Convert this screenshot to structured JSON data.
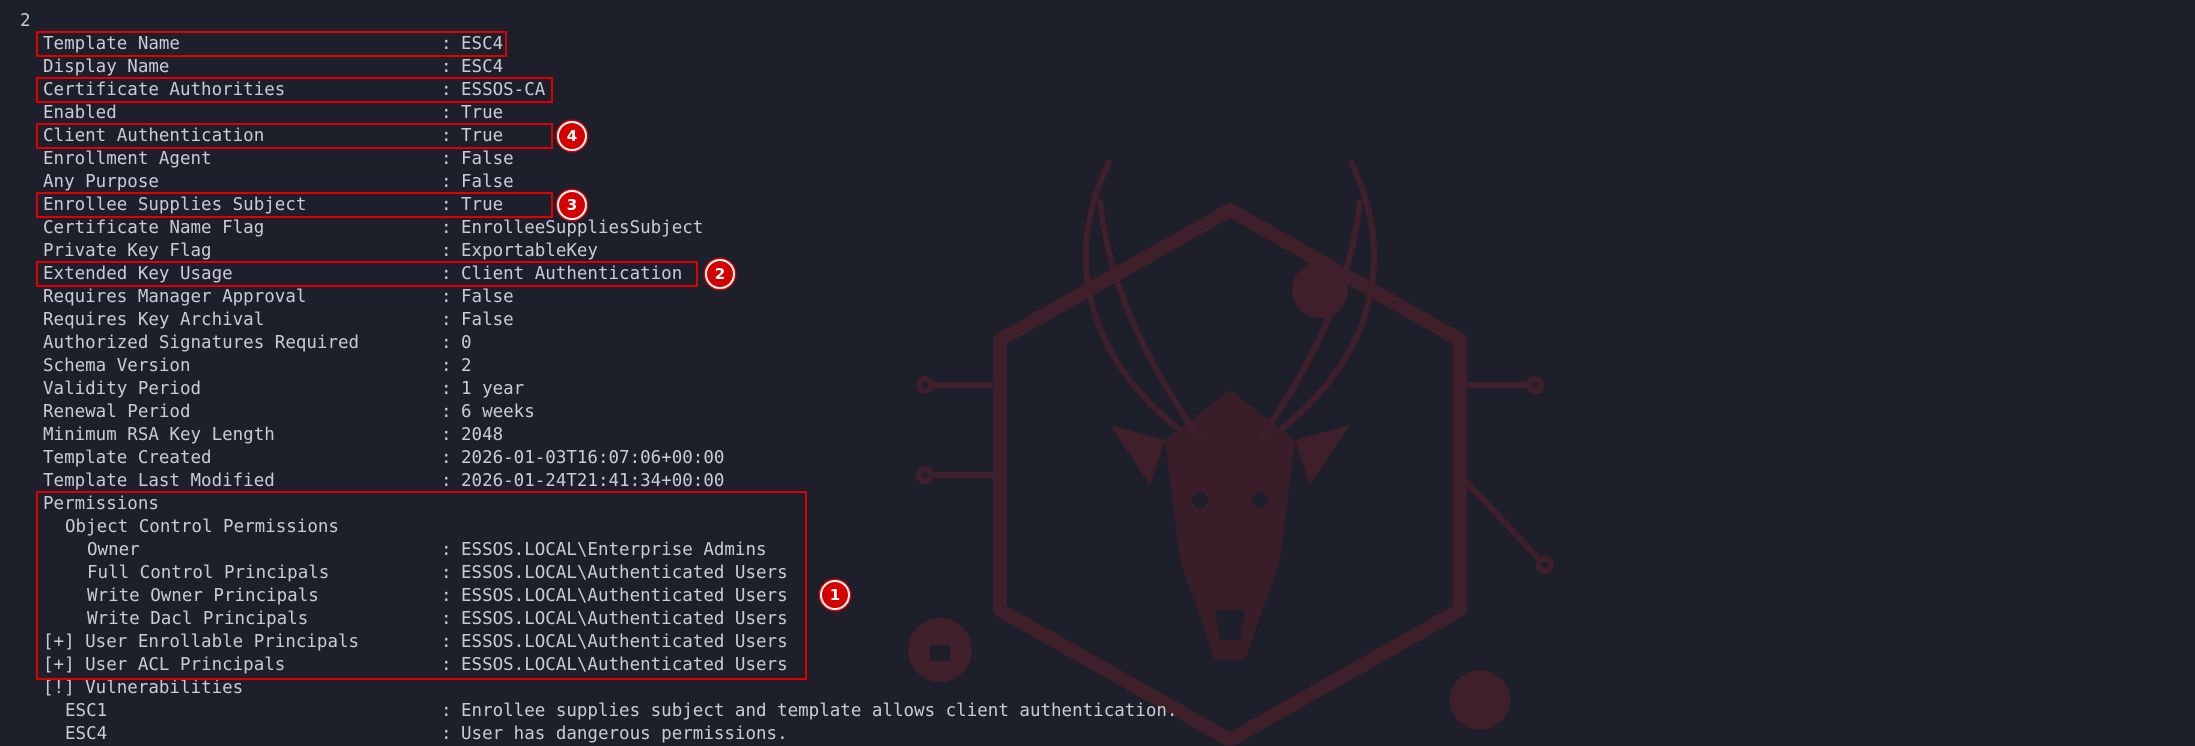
{
  "prompt_number": "2",
  "rows": [
    {
      "key": "Template Name",
      "indent": 0,
      "value": "ESC4"
    },
    {
      "key": "Display Name",
      "indent": 0,
      "value": "ESC4"
    },
    {
      "key": "Certificate Authorities",
      "indent": 0,
      "value": "ESSOS-CA"
    },
    {
      "key": "Enabled",
      "indent": 0,
      "value": "True"
    },
    {
      "key": "Client Authentication",
      "indent": 0,
      "value": "True"
    },
    {
      "key": "Enrollment Agent",
      "indent": 0,
      "value": "False"
    },
    {
      "key": "Any Purpose",
      "indent": 0,
      "value": "False"
    },
    {
      "key": "Enrollee Supplies Subject",
      "indent": 0,
      "value": "True"
    },
    {
      "key": "Certificate Name Flag",
      "indent": 0,
      "value": "EnrolleeSuppliesSubject"
    },
    {
      "key": "Private Key Flag",
      "indent": 0,
      "value": "ExportableKey"
    },
    {
      "key": "Extended Key Usage",
      "indent": 0,
      "value": "Client Authentication"
    },
    {
      "key": "Requires Manager Approval",
      "indent": 0,
      "value": "False"
    },
    {
      "key": "Requires Key Archival",
      "indent": 0,
      "value": "False"
    },
    {
      "key": "Authorized Signatures Required",
      "indent": 0,
      "value": "0"
    },
    {
      "key": "Schema Version",
      "indent": 0,
      "value": "2"
    },
    {
      "key": "Validity Period",
      "indent": 0,
      "value": "1 year"
    },
    {
      "key": "Renewal Period",
      "indent": 0,
      "value": "6 weeks"
    },
    {
      "key": "Minimum RSA Key Length",
      "indent": 0,
      "value": "2048"
    },
    {
      "key": "Template Created",
      "indent": 0,
      "value": "2026-01-03T16:07:06+00:00"
    },
    {
      "key": "Template Last Modified",
      "indent": 0,
      "value": "2026-01-24T21:41:34+00:00"
    },
    {
      "key": "Permissions",
      "indent": 0,
      "value": null
    },
    {
      "key": "Object Control Permissions",
      "indent": 1,
      "value": null
    },
    {
      "key": "Owner",
      "indent": 2,
      "value": "ESSOS.LOCAL\\Enterprise Admins"
    },
    {
      "key": "Full Control Principals",
      "indent": 2,
      "value": "ESSOS.LOCAL\\Authenticated Users"
    },
    {
      "key": "Write Owner Principals",
      "indent": 2,
      "value": "ESSOS.LOCAL\\Authenticated Users"
    },
    {
      "key": "Write Dacl Principals",
      "indent": 2,
      "value": "ESSOS.LOCAL\\Authenticated Users"
    },
    {
      "key": "[+] User Enrollable Principals",
      "indent": 0,
      "value": "ESSOS.LOCAL\\Authenticated Users"
    },
    {
      "key": "[+] User ACL Principals",
      "indent": 0,
      "value": "ESSOS.LOCAL\\Authenticated Users"
    },
    {
      "key": "[!] Vulnerabilities",
      "indent": 0,
      "value": null
    },
    {
      "key": "ESC1",
      "indent": 1,
      "value": "Enrollee supplies subject and template allows client authentication."
    },
    {
      "key": "ESC4",
      "indent": 1,
      "value": "User has dangerous permissions."
    }
  ],
  "annotations": [
    {
      "label": "1",
      "target": "Permissions"
    },
    {
      "label": "2",
      "target": "Extended Key Usage"
    },
    {
      "label": "3",
      "target": "Enrollee Supplies Subject"
    },
    {
      "label": "4",
      "target": "Client Authentication"
    }
  ],
  "watermark_icon": "goat-skull-shield-icon",
  "colors": {
    "background": "#1d1f2b",
    "text": "#c9cbd6",
    "highlight": "#e00000",
    "badge": "#d40000",
    "watermark": "#5a1f2a"
  }
}
